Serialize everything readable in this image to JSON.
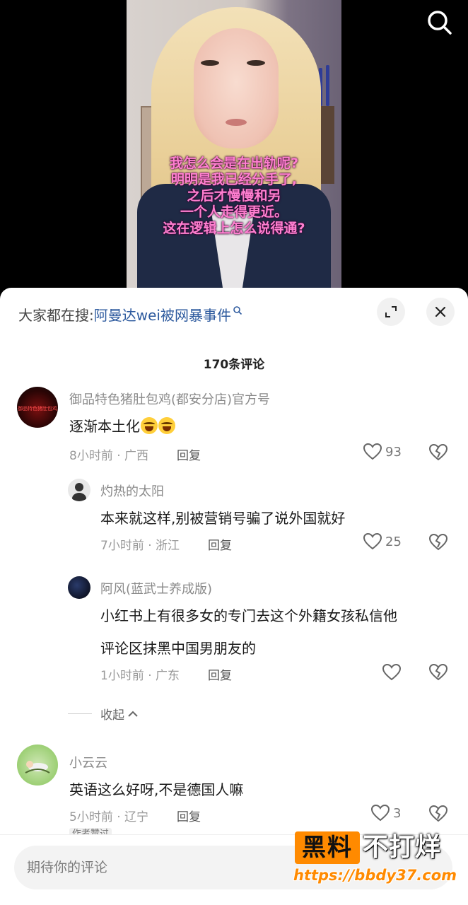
{
  "video": {
    "subtitle_lines": [
      "我怎么会是在出轨呢?",
      "明明是我已经分手了,",
      "之后才慢慢和另",
      "一个人走得更近。",
      "这在逻辑上怎么说得通?"
    ]
  },
  "sheet": {
    "search_prefix": "大家都在搜:",
    "search_keyword": "阿曼达wei被网暴事件",
    "comment_count": "170条评论",
    "collapse_label": "收起",
    "author_tag": "作者赞过"
  },
  "comments": [
    {
      "user": "御品特色猪肚包鸡(都安分店)官方号",
      "text": "逐渐本土化",
      "time_location": "8小时前 · 广西",
      "reply_label": "回复",
      "likes": "93",
      "avatar_text": "御品特色猪肚包鸡"
    },
    {
      "user": "灼热的太阳",
      "text": "本来就这样,别被营销号骗了说外国就好",
      "time_location": "7小时前 · 浙江",
      "reply_label": "回复",
      "likes": "25"
    },
    {
      "user": "阿风(蓝武士养成版)",
      "text_line1": "小红书上有很多女的专门去这个外籍女孩私信他",
      "text_line2": "评论区抹黑中国男朋友的",
      "time_location": "1小时前 · 广东",
      "reply_label": "回复",
      "likes": ""
    },
    {
      "user": "小云云",
      "text": "英语这么好呀,不是德国人嘛",
      "time_location": "5小时前 · 辽宁",
      "reply_label": "回复",
      "likes": "3"
    }
  ],
  "input": {
    "placeholder": "期待你的评论"
  },
  "watermark": {
    "left": "黑料",
    "right": "不打烊",
    "url": "https://bbdy37.com"
  },
  "colors": {
    "keyword_blue": "#2d5a9e",
    "subtitle_pink": "#ff7fd0",
    "watermark_orange": "#ff8a00"
  }
}
